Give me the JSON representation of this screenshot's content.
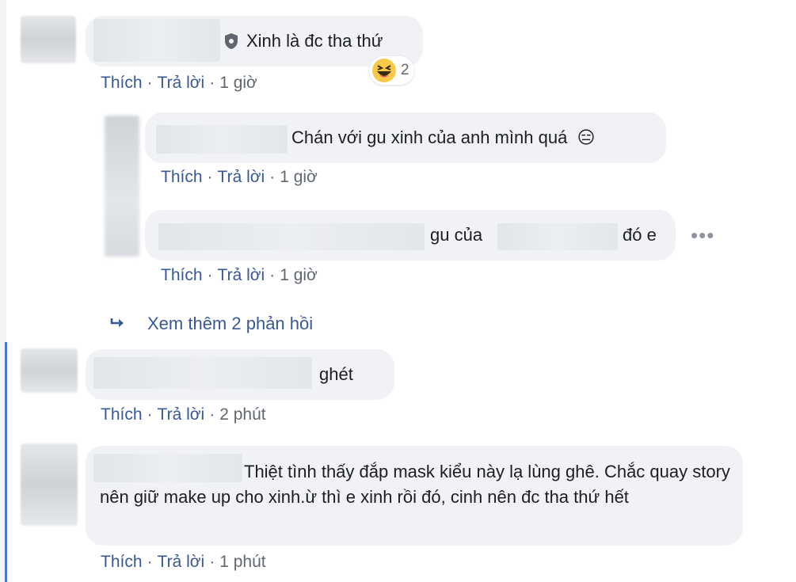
{
  "comments": [
    {
      "text": "Xinh là đc tha thứ",
      "actions": {
        "like": "Thích",
        "reply": "Trả lời",
        "time": "1 giờ"
      },
      "reaction": {
        "icon": "laughing-emoji",
        "count": "2"
      }
    },
    {
      "text": "Chán với gu xinh của anh mình quá",
      "emoji": "😑",
      "actions": {
        "like": "Thích",
        "reply": "Trả lời",
        "time": "1 giờ"
      }
    },
    {
      "text_a": "gu của",
      "text_b": "đó e",
      "actions": {
        "like": "Thích",
        "reply": "Trả lời",
        "time": "1 giờ"
      },
      "more_icon": "ellipsis-icon"
    },
    {
      "text": "ghét",
      "actions": {
        "like": "Thích",
        "reply": "Trả lời",
        "time": "2 phút"
      }
    },
    {
      "text": "Thiệt tình thấy đắp mask kiểu này lạ lùng ghê. Chắc quay story nên giữ make up cho xinh.ừ thì e xinh rồi đó, cinh nên đc tha thứ hết",
      "actions": {
        "like": "Thích",
        "reply": "Trả lời",
        "time": "1 phút"
      }
    }
  ],
  "view_more_replies": "Xem thêm 2 phản hồi",
  "separator": "·",
  "colors": {
    "link": "#385898",
    "bubble": "#f0f2f5",
    "meta": "#606770",
    "thread_line": "#4a76d6"
  }
}
